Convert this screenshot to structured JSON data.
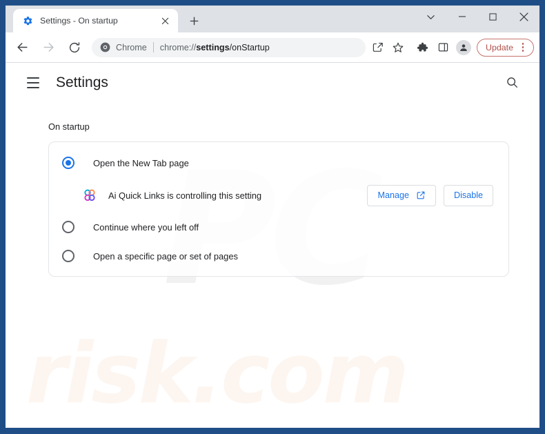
{
  "window": {
    "controls": {
      "tabsearch_label": "tab-search",
      "minimize_label": "minimize",
      "maximize_label": "maximize",
      "close_label": "close"
    }
  },
  "tabstrip": {
    "tabs": [
      {
        "title": "Settings - On startup",
        "favicon": "gear-icon",
        "close_label": "×",
        "active": true
      }
    ],
    "newtab_label": "+"
  },
  "toolbar": {
    "back_label": "back-arrow-icon",
    "forward_label": "forward-arrow-icon",
    "reload_label": "reload-icon",
    "omnibox": {
      "brand": "Chrome",
      "url_scheme": "chrome://",
      "url_host": "settings",
      "url_path": "/onStartup",
      "url_full": "chrome://settings/onStartup"
    },
    "icons": [
      {
        "name": "share-icon"
      },
      {
        "name": "bookmark-star-icon"
      },
      {
        "name": "extensions-puzzle-icon"
      },
      {
        "name": "side-panel-icon"
      },
      {
        "name": "profile-avatar-icon"
      }
    ],
    "update_button": {
      "label": "Update",
      "color": "#b0504a",
      "border_color": "#c5736c"
    },
    "menu_label": "three-dot-menu"
  },
  "settings": {
    "header": {
      "menu_label": "hamburger-menu",
      "title": "Settings",
      "search_label": "search-icon"
    },
    "section_label": "On startup",
    "options": [
      {
        "label": "Open the New Tab page",
        "selected": true
      },
      {
        "label": "Continue where you left off",
        "selected": false
      },
      {
        "label": "Open a specific page or set of pages",
        "selected": false
      }
    ],
    "extension_notice": {
      "icon": "ai-quick-links-extension-icon",
      "text": "Ai Quick Links is controlling this setting",
      "manage_label": "Manage",
      "manage_icon": "external-link-icon",
      "disable_label": "Disable"
    }
  },
  "watermarks": {
    "logo": "PC",
    "domain": "risk.com"
  },
  "colors": {
    "window_frame": "#1f4e87",
    "accent_blue": "#1a73e8",
    "tabstrip_bg": "#dee1e6",
    "omnibox_bg": "#f1f3f4",
    "update_red": "#b0504a"
  }
}
